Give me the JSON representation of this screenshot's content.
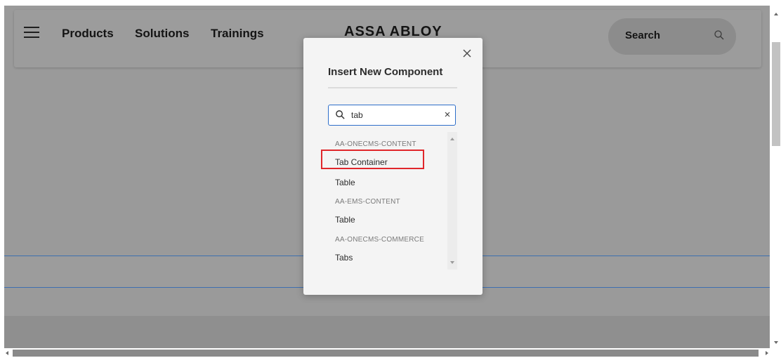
{
  "header": {
    "nav_items": [
      "Products",
      "Solutions",
      "Trainings"
    ],
    "logo_text": "ASSA ABLOY",
    "search_label": "Search"
  },
  "dialog": {
    "title": "Insert New Component",
    "search": {
      "value": "tab",
      "placeholder": ""
    },
    "results": [
      {
        "group": "AA-ONECMS-CONTENT",
        "items": [
          "Tab Container",
          "Table"
        ]
      },
      {
        "group": "AA-EMS-CONTENT",
        "items": [
          "Table"
        ]
      },
      {
        "group": "AA-ONECMS-COMMERCE",
        "items": [
          "Tabs"
        ]
      }
    ],
    "highlighted_item": "Tab Container"
  },
  "colors": {
    "overlay_gray": "#9a9a9a",
    "dialog_bg": "#f4f4f4",
    "focus_blue": "#2d6ec9",
    "highlight_red": "#e0262b"
  },
  "icons": {
    "menu": "hamburger-icon",
    "search": "search-icon",
    "close": "close-icon",
    "clear": "clear-icon"
  }
}
